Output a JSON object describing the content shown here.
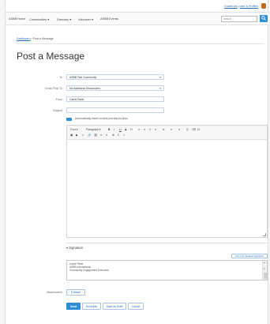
{
  "topbar": {
    "link1": "Guides list",
    "link2": "user & Profiles"
  },
  "nav": {
    "items": [
      "ASBB Home",
      "Communities",
      "Directory",
      "Volunteer",
      "ASBB Events"
    ],
    "search_placeholder": "search",
    "search_icon": "magnifier-icon"
  },
  "breadcrumb": {
    "root": "Dashboard",
    "current": "Post a Message"
  },
  "page_title": "Post a Message",
  "form": {
    "to_label": "To",
    "to_value": "ASBB Test Community",
    "crosspost_label": "Cross Post To",
    "crosspost_value": "No Additional Discussions",
    "from_label": "From",
    "from_value": "Carrie Redd",
    "subject_label": "Subject",
    "subject_value": "",
    "include_text": "Automatically insert content preview for links"
  },
  "editor": {
    "toolbar_row1": [
      "Font",
      "Paragraph",
      "B",
      "I",
      "U",
      "S",
      "H",
      "≡",
      "≡",
      "≡",
      "≡",
      "A",
      "≡",
      "≡",
      "⎘",
      "⌫",
      "Ω"
    ],
    "toolbar_row2": [
      "▣",
      "▶",
      "☺",
      "🔗",
      "⛓",
      "≡",
      "≡",
      "⊕",
      "Σ",
      "⌗"
    ],
    "font_label": "Font",
    "paragraph_label": "Paragraph"
  },
  "signature": {
    "heading": "▾ Signature",
    "use_default_label": "Use Your Default Signature",
    "lines": [
      "Carrie Redd",
      "ASBB International",
      "Community Engagement Executive"
    ]
  },
  "attachments": {
    "label": "Attachments",
    "button_label": "Attach"
  },
  "actions": {
    "send": "Send",
    "schedule": "Schedule",
    "save_draft": "Save as Draft",
    "cancel": "Cancel"
  }
}
